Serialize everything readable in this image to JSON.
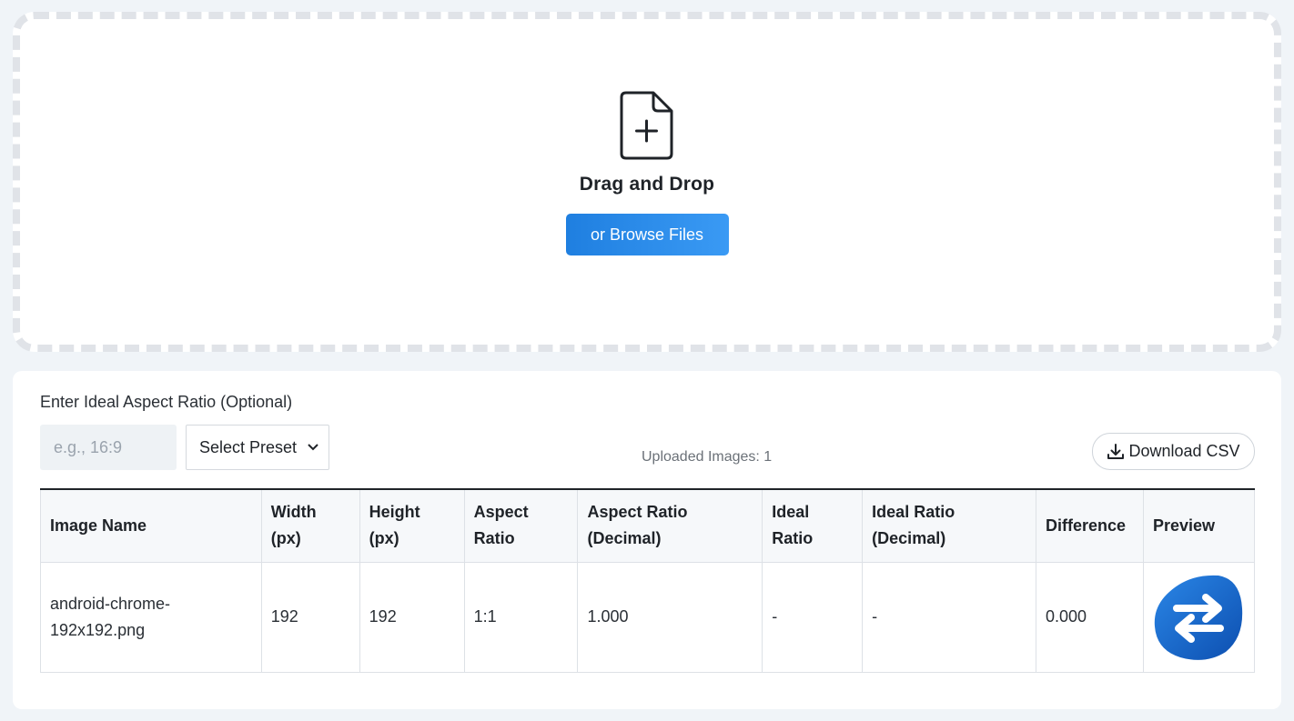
{
  "dropzone": {
    "icon": "file-plus-icon",
    "title": "Drag and Drop",
    "browse_label": "or Browse Files"
  },
  "ratio": {
    "label": "Enter Ideal Aspect Ratio (Optional)",
    "input_value": "",
    "input_placeholder": "e.g., 16:9",
    "preset_selected": "Select Preset"
  },
  "uploaded_text": "Uploaded Images: 1",
  "download_csv_label": "Download CSV",
  "table": {
    "headers": [
      "Image Name",
      "Width (px)",
      "Height (px)",
      "Aspect Ratio",
      "Aspect Ratio (Decimal)",
      "Ideal Ratio",
      "Ideal Ratio (Decimal)",
      "Difference",
      "Preview"
    ],
    "rows": [
      {
        "name": "android-chrome-192x192.png",
        "width": "192",
        "height": "192",
        "aspect_ratio": "1:1",
        "aspect_decimal": "1.000",
        "ideal_ratio": "-",
        "ideal_decimal": "-",
        "difference": "0.000",
        "preview_icon": "swap-arrows-logo-icon"
      }
    ]
  },
  "colors": {
    "accent": "#2a8cec",
    "page_bg": "#f0f4f8",
    "dashed_border": "#e0e3e8",
    "logo_blue": "#1565c8"
  }
}
